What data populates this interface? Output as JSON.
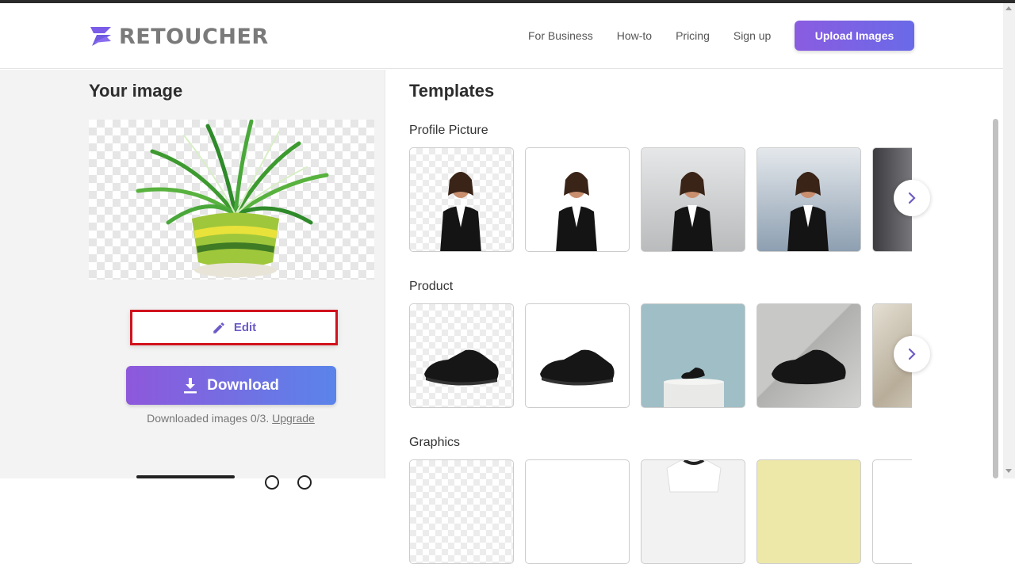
{
  "header": {
    "logo_text": "RETOUCHER",
    "nav": [
      "For Business",
      "How-to",
      "Pricing",
      "Sign up"
    ],
    "upload_label": "Upload Images"
  },
  "left_panel": {
    "title": "Your image",
    "edit_label": "Edit",
    "download_label": "Download",
    "downloaded_note": "Downloaded images 0/3.",
    "upgrade_link": "Upgrade"
  },
  "templates": {
    "title": "Templates",
    "sections": [
      {
        "title": "Profile Picture",
        "backgrounds": [
          "transparent",
          "white",
          "light-gray-gradient",
          "blue-gray-gradient",
          "dark-gray"
        ]
      },
      {
        "title": "Product",
        "backgrounds": [
          "transparent",
          "white",
          "teal-with-pedestal",
          "gray-geometric",
          "marble"
        ]
      },
      {
        "title": "Graphics",
        "backgrounds": [
          "transparent",
          "white",
          "white-tshirt",
          "pale-yellow",
          "white"
        ]
      }
    ]
  },
  "colors": {
    "accent_purple": "#8a5ce0",
    "accent_blue": "#5a84ea",
    "highlight_red": "#d1121e"
  },
  "icons": [
    "logo-icon",
    "pencil-icon",
    "download-icon",
    "chevron-right-icon"
  ]
}
